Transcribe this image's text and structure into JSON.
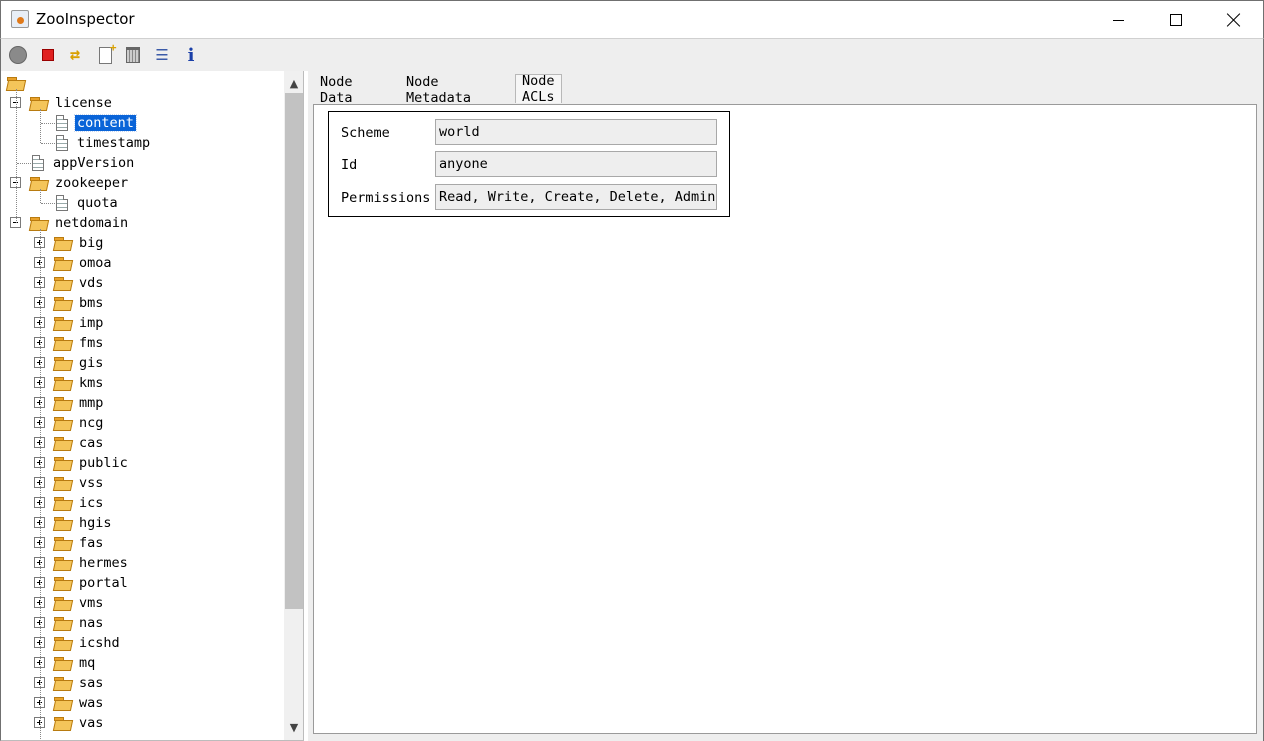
{
  "window": {
    "title": "ZooInspector"
  },
  "toolbar": {
    "buttons": [
      {
        "name": "connect",
        "icon": "connect-icon"
      },
      {
        "name": "disconnect",
        "icon": "disconnect-icon"
      },
      {
        "name": "refresh",
        "icon": "refresh-icon"
      },
      {
        "name": "add-node",
        "icon": "add-node-icon"
      },
      {
        "name": "delete-node",
        "icon": "trash-icon"
      },
      {
        "name": "node-viewers",
        "icon": "edit-icon"
      },
      {
        "name": "about",
        "icon": "info-icon",
        "glyph": "i"
      }
    ]
  },
  "tree": {
    "root": "",
    "license": {
      "label": "license",
      "children": [
        "content",
        "timestamp"
      ],
      "selected": "content"
    },
    "appVersion": "appVersion",
    "zookeeper": {
      "label": "zookeeper",
      "children": [
        "quota"
      ]
    },
    "netdomain": {
      "label": "netdomain",
      "children": [
        "big",
        "omoa",
        "vds",
        "bms",
        "imp",
        "fms",
        "gis",
        "kms",
        "mmp",
        "ncg",
        "cas",
        "public",
        "vss",
        "ics",
        "hgis",
        "fas",
        "hermes",
        "portal",
        "vms",
        "nas",
        "icshd",
        "mq",
        "sas",
        "was",
        "vas"
      ]
    }
  },
  "tabs": [
    {
      "label": "Node Data"
    },
    {
      "label": "Node Metadata"
    },
    {
      "label": "Node ACLs",
      "active": true
    }
  ],
  "acl": {
    "scheme_label": "Scheme",
    "scheme_value": "world",
    "id_label": "Id",
    "id_value": "anyone",
    "permissions_label": "Permissions",
    "permissions_value": "Read, Write, Create, Delete, Admin"
  },
  "colors": {
    "selection": "#0a64d8",
    "folder": "#f4c55a",
    "panel_bg": "#eeeeee"
  }
}
